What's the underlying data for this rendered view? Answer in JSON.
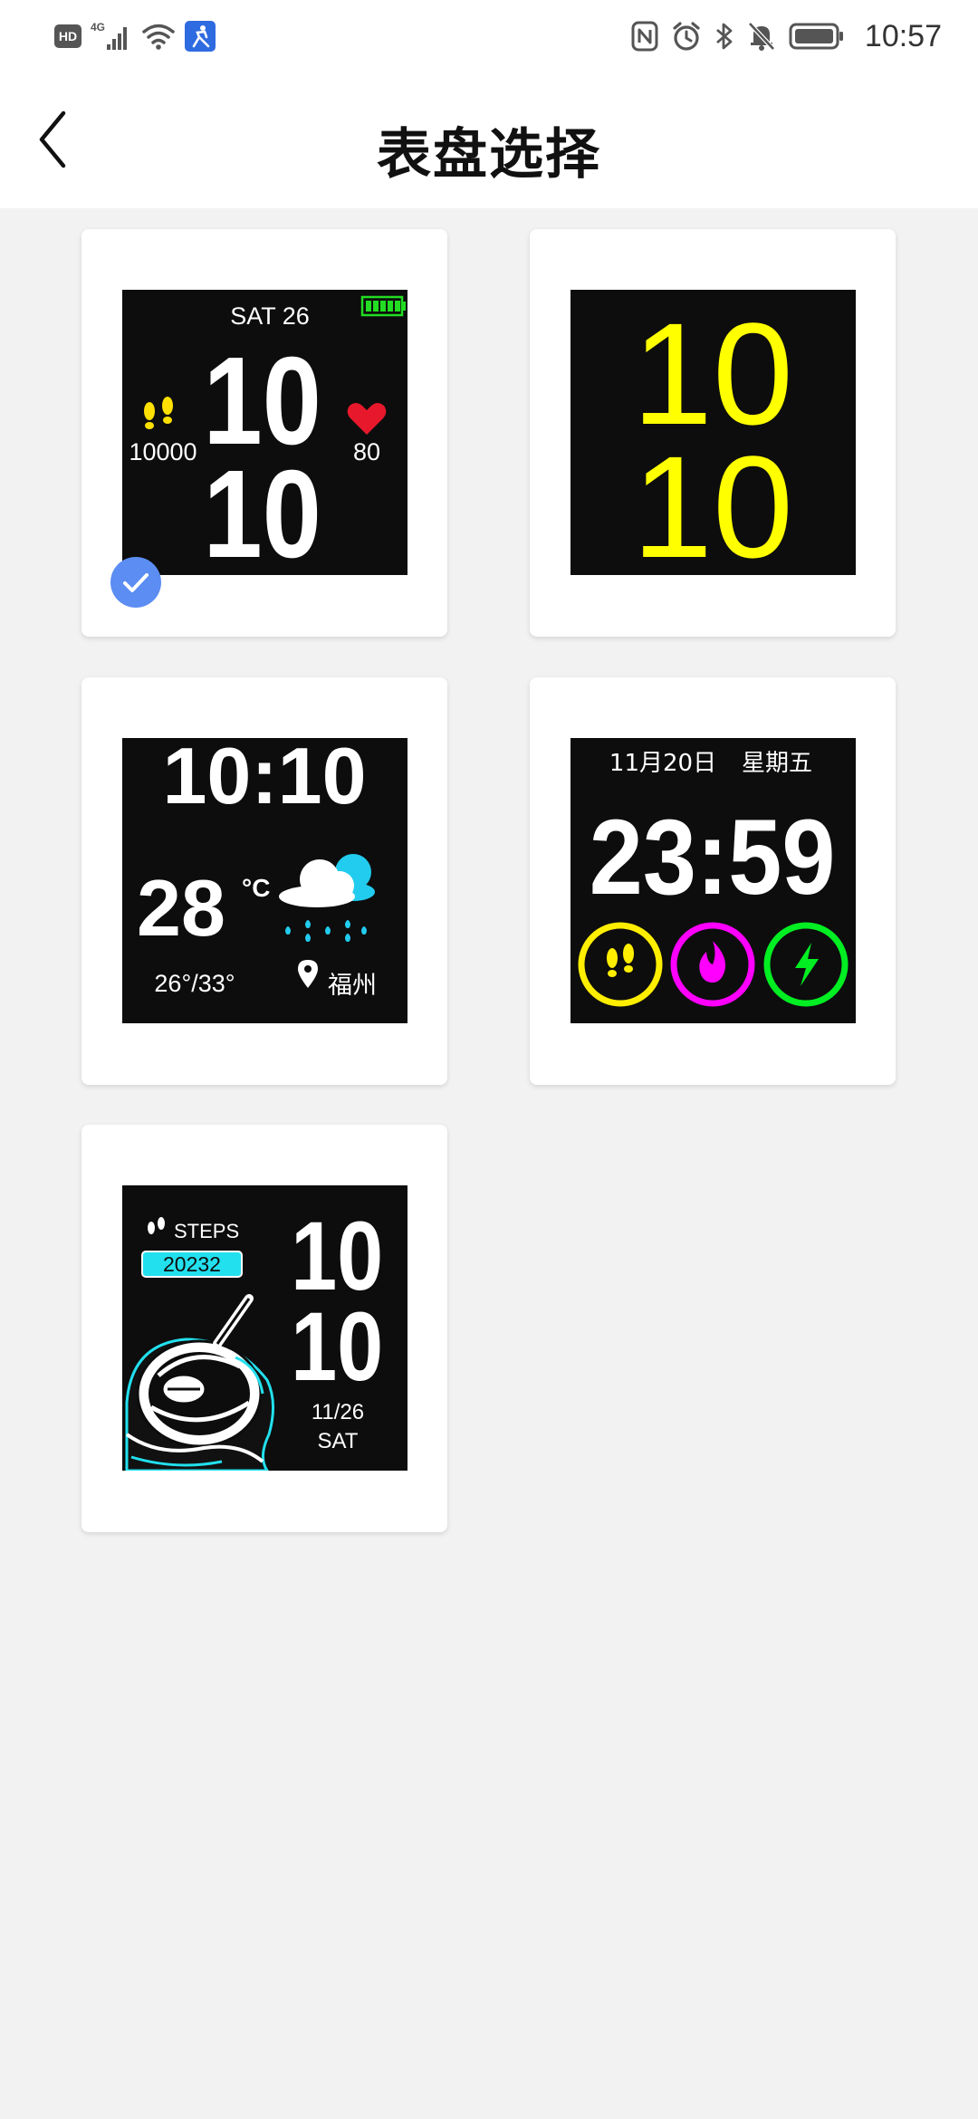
{
  "status_bar": {
    "hd_label": "HD",
    "network_label": "4G",
    "time": "10:57",
    "icons": [
      "hd-icon",
      "signal-icon",
      "wifi-icon",
      "app-notification-icon",
      "nfc-icon",
      "alarm-icon",
      "bluetooth-icon",
      "mute-icon",
      "battery-icon"
    ]
  },
  "header": {
    "title": "表盘选择",
    "back_icon": "chevron-left-icon"
  },
  "faces": [
    {
      "selected": true,
      "date": "SAT 26",
      "hour": "10",
      "minute": "10",
      "steps": "10000",
      "heart_rate": "80",
      "icons": [
        "battery-icon",
        "footprint-icon",
        "heart-icon"
      ],
      "colors": {
        "accent": "#ffe000",
        "heart": "#e8182c",
        "battery": "#22dd22"
      }
    },
    {
      "hour": "10",
      "minute": "10",
      "colors": {
        "digits": "#ffff00"
      }
    },
    {
      "time": "10:10",
      "temperature": "28",
      "temp_unit": "°C",
      "temp_range": "26°/33°",
      "city": "福州",
      "icons": [
        "cloud-rain-icon",
        "location-pin-icon"
      ],
      "colors": {
        "cloud_accent": "#22ccee",
        "rain": "#22ccee"
      }
    },
    {
      "date": "11月20日",
      "weekday": "星期五",
      "time": "23:59",
      "icons": [
        "footprint-icon",
        "flame-icon",
        "lightning-icon"
      ],
      "colors": {
        "ring1": "#ffee00",
        "ring2": "#ff00ff",
        "ring3": "#00ee22"
      }
    },
    {
      "steps_label": "STEPS",
      "steps_value": "20232",
      "hour": "10",
      "minute": "10",
      "date": "11/26",
      "weekday": "SAT",
      "icons": [
        "footprint-icon",
        "astronaut-illustration"
      ],
      "colors": {
        "accent": "#22e0ee"
      }
    }
  ],
  "colors": {
    "background": "#f2f2f2",
    "card": "#ffffff",
    "check_badge": "#5b8df2"
  }
}
